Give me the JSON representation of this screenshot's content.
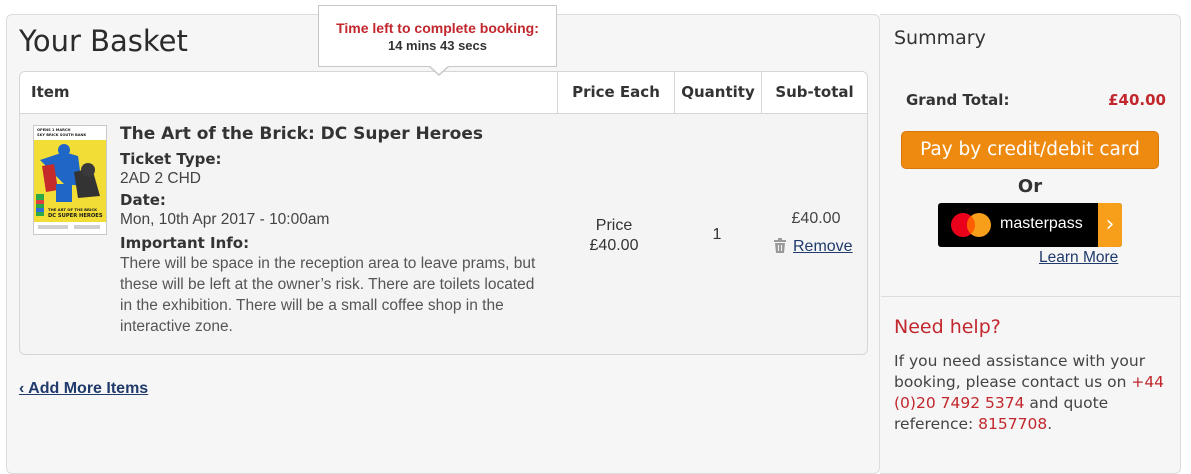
{
  "page_title": "Your Basket",
  "timer": {
    "label": "Time left to complete booking:",
    "value": "14 mins 43 secs"
  },
  "table": {
    "headers": {
      "item": "Item",
      "price": "Price Each",
      "quantity": "Quantity",
      "subtotal": "Sub-total"
    },
    "row": {
      "name": "The Art of the Brick: DC Super Heroes",
      "ticket_type_label": "Ticket Type:",
      "ticket_type": "2AD 2 CHD",
      "date_label": "Date:",
      "date": "Mon, 10th Apr 2017 - 10:00am",
      "info_label": "Important Info:",
      "info": "There will be space in the reception area to leave prams, but these will be left at the owner’s risk. There are toilets located in the exhibition. There will be a small coffee shop in the interactive zone.",
      "price_label": "Price",
      "price": "£40.00",
      "quantity": "1",
      "subtotal": "£40.00",
      "remove_label": "Remove",
      "poster_text_top": "OPENS 1 MARCH\nSKY BRICK SOUTH BANK",
      "poster_title": "THE ART OF THE BRICK\nDC SUPER HEROES"
    }
  },
  "add_more_label": "‹ Add More Items",
  "summary": {
    "title": "Summary",
    "grand_total_label": "Grand Total:",
    "grand_total": "£40.00",
    "pay_button": "Pay by credit/debit card",
    "or_label": "Or",
    "masterpass_label": "masterpass",
    "learn_more": "Learn More"
  },
  "help": {
    "title": "Need help?",
    "text_before": "If you need assistance with your booking, please contact us on ",
    "phone": "+44 (0)20 7492 5374",
    "text_middle": " and quote reference: ",
    "reference": "8157708",
    "text_end": "."
  },
  "colors": {
    "accent_red": "#c1272d",
    "pay_orange": "#ef8a10",
    "link_blue": "#1f3a6b"
  }
}
